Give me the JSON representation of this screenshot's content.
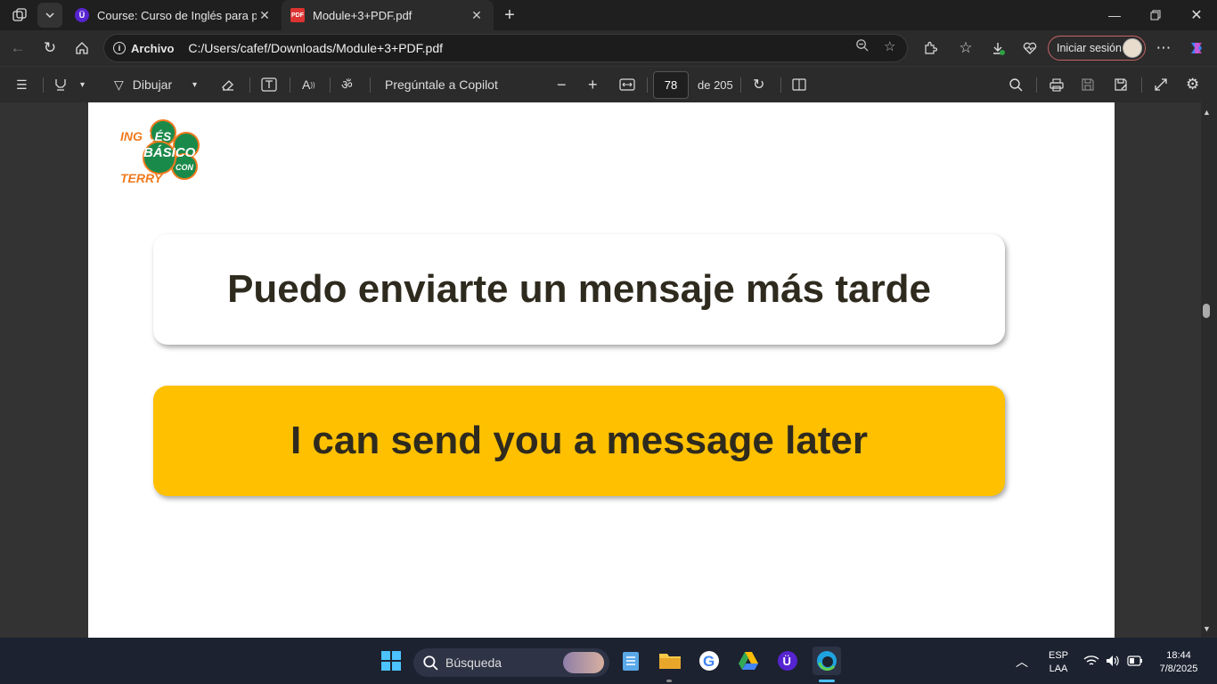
{
  "tabs": [
    {
      "title": "Course: Curso de Inglés para principiantes",
      "active": false,
      "favicon": "udemy-u-icon"
    },
    {
      "title": "Module+3+PDF.pdf",
      "active": true,
      "favicon": "pdf-icon"
    }
  ],
  "address": {
    "site_label": "Archivo",
    "path": "C:/Users/cafef/Downloads/Module+3+PDF.pdf",
    "signin_label": "Iniciar sesión"
  },
  "pdf_toolbar": {
    "draw_label": "Dibujar",
    "copilot_label": "Pregúntale a Copilot",
    "page_current": "78",
    "page_total_label": "de 205"
  },
  "document": {
    "logo_text_top": "INGLÉS",
    "logo_text_mid": "BÁSICO",
    "logo_text_con": "CON",
    "logo_text_bottom": "TERRY",
    "spanish_phrase": "Puedo enviarte un mensaje más tarde",
    "english_phrase": "I can send you a message later",
    "colors": {
      "highlight": "#ffc000",
      "text": "#2e2a1e",
      "logo_green": "#1a8a4a",
      "logo_orange": "#f07a1e"
    }
  },
  "taskbar": {
    "search_placeholder": "Búsqueda",
    "lang_top": "ESP",
    "lang_bottom": "LAA",
    "time": "18:44",
    "date": "7/8/2025"
  }
}
